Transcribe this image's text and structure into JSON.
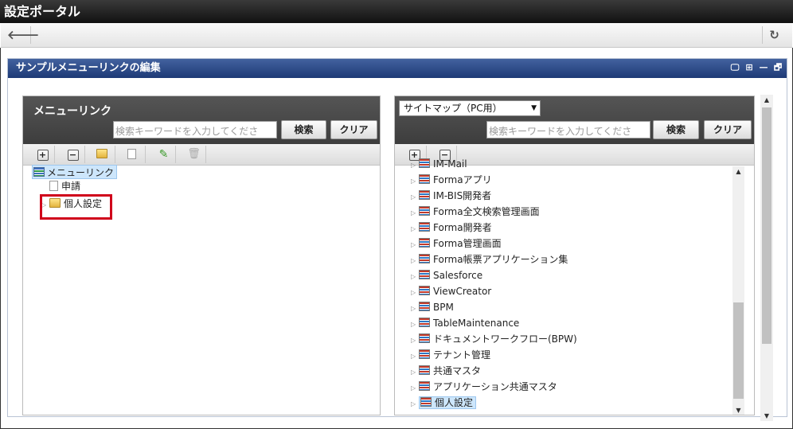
{
  "app": {
    "title": "設定ポータル"
  },
  "nav": {
    "back_icon": "arrow-left-icon",
    "reload_icon": "reload-icon",
    "back_glyph": "🡐",
    "reload_glyph": "↻"
  },
  "portlet": {
    "title": "サンプルメニューリンクの編集",
    "icons": [
      "monitor-icon",
      "maximize-icon",
      "minimize-icon",
      "restore-icon"
    ],
    "icon_glyphs": [
      "🖵",
      "⊞",
      "—",
      "🗗"
    ]
  },
  "left_panel": {
    "title": "メニューリンク",
    "search_placeholder": "検索キーワードを入力してくださ",
    "search_button": "検索",
    "clear_button": "クリア",
    "toolbar": {
      "add": "+",
      "remove": "−",
      "folder": "folder-add-icon",
      "page": "page-add-icon",
      "edit": "pencil-icon",
      "delete": "trash-icon"
    },
    "tree": {
      "root": "メニューリンク",
      "children": [
        "申請",
        "個人設定"
      ]
    }
  },
  "right_panel": {
    "select_value": "サイトマップ（PC用）",
    "search_placeholder": "検索キーワードを入力してくださ",
    "search_button": "検索",
    "clear_button": "クリア",
    "toolbar": {
      "add": "+",
      "remove": "−"
    },
    "items": [
      "IM-Mail",
      "Formaアプリ",
      "IM-BIS開発者",
      "Forma全文検索管理画面",
      "Forma開発者",
      "Forma管理画面",
      "Forma帳票アプリケーション集",
      "Salesforce",
      "ViewCreator",
      "BPM",
      "TableMaintenance",
      "ドキュメントワークフロー(BPW)",
      "テナント管理",
      "共通マスタ",
      "アプリケーション共通マスタ",
      "個人設定"
    ]
  },
  "colors": {
    "title_bar": "#1a1a1a",
    "portlet_header": "#2b4a8a",
    "highlight": "#d0021b",
    "selection": "#cde6fb"
  }
}
